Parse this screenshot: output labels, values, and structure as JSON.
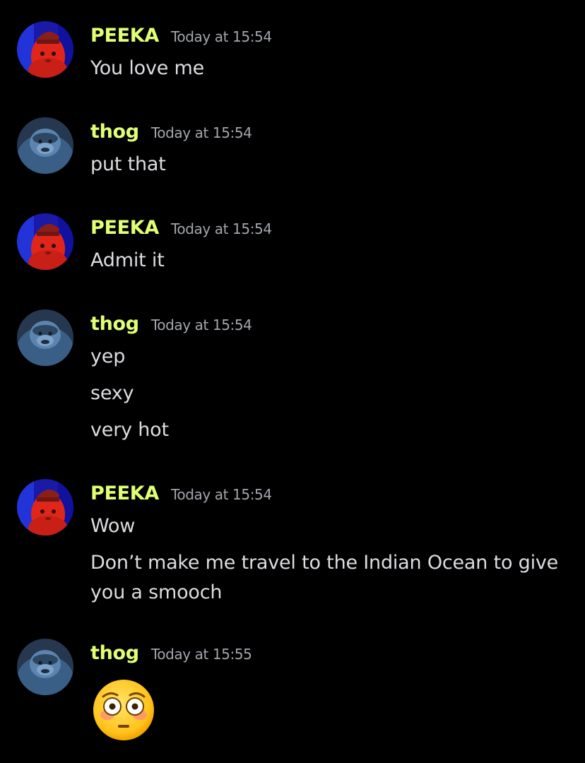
{
  "chat": {
    "messages": [
      {
        "author": "PEEKA",
        "timestamp": "Today at 15:54",
        "lines": [
          "You love me"
        ]
      },
      {
        "author": "thog",
        "timestamp": "Today at 15:54",
        "lines": [
          "put that"
        ]
      },
      {
        "author": "PEEKA",
        "timestamp": "Today at 15:54",
        "lines": [
          "Admit it"
        ]
      },
      {
        "author": "thog",
        "timestamp": "Today at 15:54",
        "lines": [
          "yep",
          "sexy",
          "very hot"
        ]
      },
      {
        "author": "PEEKA",
        "timestamp": "Today at 15:54",
        "lines": [
          "Wow",
          "Don’t make me travel to the Indian Ocean to give you a smooch"
        ]
      },
      {
        "author": "thog",
        "timestamp": "Today at 15:55",
        "emoji": "flushed-face"
      }
    ]
  },
  "colors": {
    "background": "#000000",
    "username": "#e1ff74",
    "timestamp": "#a3a6ad",
    "message_text": "#dcdde1"
  }
}
